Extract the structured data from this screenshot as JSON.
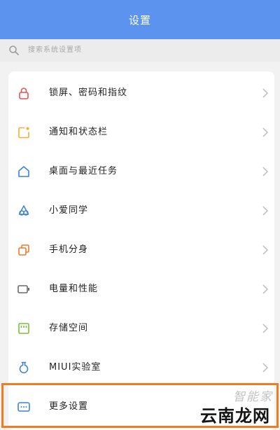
{
  "header": {
    "title": "设置",
    "bg_color": "#5b93ee"
  },
  "search": {
    "placeholder": "搜索系统设置项",
    "icon": "search-icon"
  },
  "settings": {
    "items": [
      {
        "label": "锁屏、密码和指纹",
        "icon": "lock-icon",
        "icon_color": "#e25550"
      },
      {
        "label": "通知和状态栏",
        "icon": "notification-icon",
        "icon_color": "#f0b036"
      },
      {
        "label": "桌面与最近任务",
        "icon": "home-icon",
        "icon_color": "#3b84d6"
      },
      {
        "label": "小爱同学",
        "icon": "xiaoai-icon",
        "icon_color": "#3b84d6"
      },
      {
        "label": "手机分身",
        "icon": "second-space-icon",
        "icon_color": "#ef7a2c"
      },
      {
        "label": "电量和性能",
        "icon": "battery-icon",
        "icon_color": "#6a6a6a"
      },
      {
        "label": "存储空间",
        "icon": "storage-icon",
        "icon_color": "#7cbf3d"
      },
      {
        "label": "MIUI实验室",
        "icon": "lab-icon",
        "icon_color": "#3b84d6"
      },
      {
        "label": "更多设置",
        "icon": "more-icon",
        "icon_color": "#3b84d6"
      }
    ]
  },
  "highlight": {
    "target": "更多设置",
    "color": "#ee7d22"
  },
  "watermark": {
    "top_text": "智能家",
    "bottom_text": "云南龙网"
  }
}
